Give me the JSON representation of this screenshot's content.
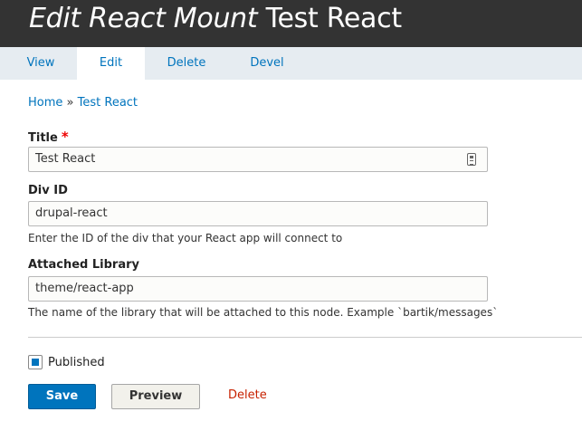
{
  "header": {
    "title_em": "Edit React Mount",
    "title_rest": "Test React"
  },
  "tabs": [
    {
      "label": "View",
      "active": false
    },
    {
      "label": "Edit",
      "active": true
    },
    {
      "label": "Delete",
      "active": false
    },
    {
      "label": "Devel",
      "active": false
    }
  ],
  "breadcrumb": {
    "home": "Home",
    "separator": "»",
    "current": "Test React"
  },
  "form": {
    "title": {
      "label": "Title",
      "required_marker": "*",
      "value": "Test React"
    },
    "div_id": {
      "label": "Div ID",
      "value": "drupal-react",
      "description": "Enter the ID of the div that your React app will connect to"
    },
    "library": {
      "label": "Attached Library",
      "value": "theme/react-app",
      "description": "The name of the library that will be attached to this node. Example `bartik/messages`"
    },
    "published": {
      "label": "Published",
      "checked": true
    }
  },
  "actions": {
    "save": "Save",
    "preview": "Preview",
    "delete": "Delete"
  },
  "colors": {
    "accent": "#0074bd",
    "header_bg": "#333333",
    "tab_bar_bg": "#e6ecf1",
    "danger": "#c72100",
    "required": "#ee0000"
  }
}
